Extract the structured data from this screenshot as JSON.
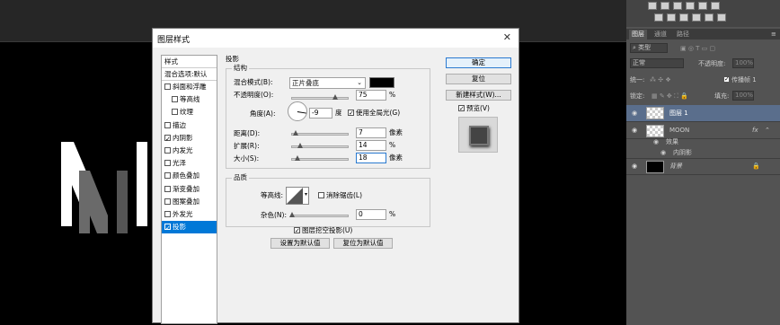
{
  "dialog": {
    "title": "图层样式",
    "close": "✕",
    "style_list": [
      {
        "label": "样式",
        "type": "header"
      },
      {
        "label": "混合选项:默认",
        "type": "header"
      },
      {
        "label": "斜面和浮雕",
        "checked": false
      },
      {
        "label": "等高线",
        "checked": false,
        "indent": true
      },
      {
        "label": "纹理",
        "checked": false,
        "indent": true
      },
      {
        "label": "描边",
        "checked": false
      },
      {
        "label": "内阴影",
        "checked": true
      },
      {
        "label": "内发光",
        "checked": false
      },
      {
        "label": "光泽",
        "checked": false
      },
      {
        "label": "颜色叠加",
        "checked": false
      },
      {
        "label": "渐变叠加",
        "checked": false
      },
      {
        "label": "图案叠加",
        "checked": false
      },
      {
        "label": "外发光",
        "checked": false
      },
      {
        "label": "投影",
        "checked": true,
        "selected": true
      }
    ],
    "section_title": "投影",
    "structure": {
      "legend": "结构",
      "blend_mode_label": "混合模式(B):",
      "blend_mode_value": "正片叠底",
      "blend_color": "#000000",
      "opacity_label": "不透明度(O):",
      "opacity_value": "75",
      "opacity_unit": "%",
      "opacity_fraction": 0.75,
      "angle_label": "角度(A):",
      "angle_value": "-9",
      "angle_unit": "度",
      "global_light_label": "使用全局光(G)",
      "global_light_checked": true,
      "distance_label": "距离(D):",
      "distance_value": "7",
      "distance_unit": "像素",
      "spread_label": "扩展(R):",
      "spread_value": "14",
      "spread_unit": "%",
      "size_label": "大小(S):",
      "size_value": "18",
      "size_unit": "像素"
    },
    "quality": {
      "legend": "品质",
      "contour_label": "等高线:",
      "antialias_label": "消除锯齿(L)",
      "antialias_checked": false,
      "noise_label": "杂色(N):",
      "noise_value": "0",
      "noise_unit": "%"
    },
    "knockout_label": "图层挖空投影(U)",
    "knockout_checked": true,
    "set_default_label": "设置为默认值",
    "reset_default_label": "复位为默认值",
    "ok_label": "确定",
    "reset_label": "复位",
    "new_style_label": "新建样式(W)...",
    "preview_label": "预览(V)",
    "preview_checked": true
  },
  "canvas": {
    "art_letter": "M"
  },
  "panel": {
    "tabs": [
      "图层",
      "通道",
      "路径"
    ],
    "kind_label": "类型",
    "blend_mode": "正常",
    "opacity_label": "不透明度:",
    "opacity_value": "100%",
    "lock_label": "锁定:",
    "fill_label": "填充:",
    "fill_value": "100%",
    "unify_label": "统一:",
    "propagate_label": "传播帧 1",
    "layers": [
      {
        "name": "图层 1",
        "selected": true
      },
      {
        "name": "MOON",
        "fx": "fx"
      },
      {
        "name": "效果",
        "sub": true
      },
      {
        "name": "内阴影",
        "sub2": true
      },
      {
        "name": "背景",
        "locked": true
      }
    ]
  },
  "colors": {
    "selection": "#0078d7",
    "panel": "#535353",
    "canvas": "#000000",
    "layer_selected": "#5a6e8c"
  }
}
